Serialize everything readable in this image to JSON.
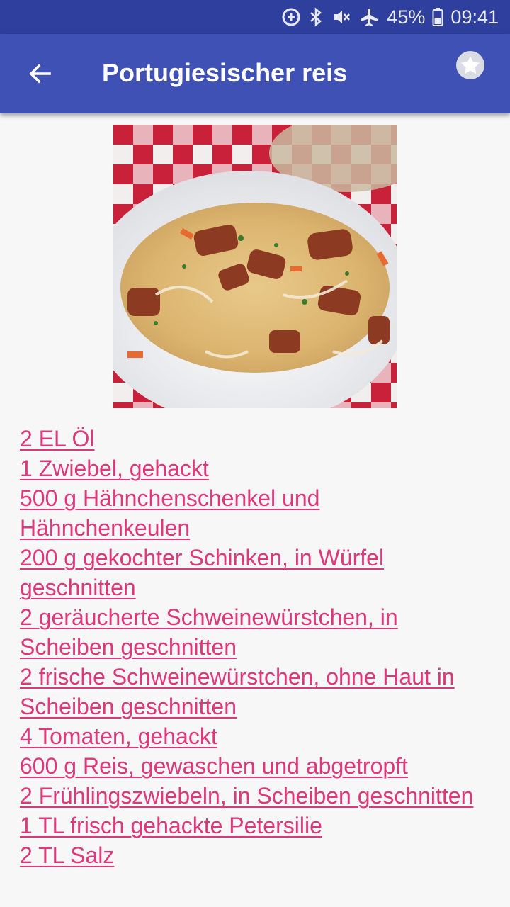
{
  "status_bar": {
    "battery": "45%",
    "time": "09:41",
    "icons": [
      "data-saver-icon",
      "bluetooth-icon",
      "vibrate-mute-icon",
      "airplane-icon",
      "battery-icon"
    ]
  },
  "app_bar": {
    "title": "Portugiesischer reis",
    "back_icon": "arrow-back-icon",
    "favorite_icon": "star-icon"
  },
  "colors": {
    "app_bar": "#3f51b5",
    "status_bar": "#2f3f9e",
    "link": "#e0367a",
    "background": "#f7f7f7"
  },
  "ingredients": [
    "2 EL Öl",
    "1 Zwiebel, gehackt",
    "500 g Hähnchenschenkel und Hähnchenkeulen",
    "200 g gekochter Schinken, in Würfel geschnitten",
    "2 geräucherte Schweinewürstchen, in Scheiben geschnitten",
    "2 frische Schweinewürstchen, ohne Haut in Scheiben geschnitten",
    "4 Tomaten, gehackt",
    "600 g Reis, gewaschen und abgetropft",
    "2 Frühlingszwiebeln, in Scheiben geschnitten",
    "1 TL frisch gehackte Petersilie",
    "2 TL Salz"
  ]
}
